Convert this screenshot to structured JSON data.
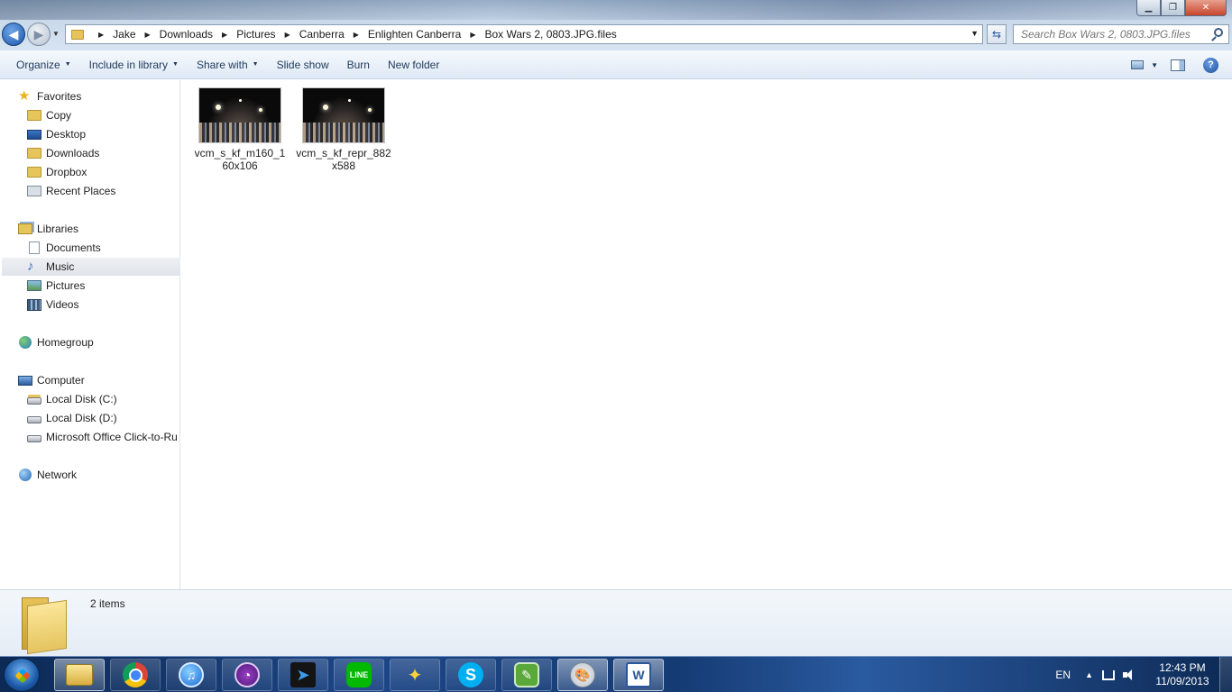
{
  "window": {
    "minimize_symbol": "▁",
    "restore_symbol": "❐",
    "close_symbol": "✕"
  },
  "address": {
    "breadcrumbs": [
      "Jake",
      "Downloads",
      "Pictures",
      "Canberra",
      "Enlighten Canberra",
      "Box Wars 2, 0803.JPG.files"
    ],
    "search_placeholder": "Search Box Wars 2, 0803.JPG.files"
  },
  "toolbar": {
    "organize": "Organize",
    "include_in_library": "Include in library",
    "share_with": "Share with",
    "slide_show": "Slide show",
    "burn": "Burn",
    "new_folder": "New folder",
    "help": "?"
  },
  "navigation": {
    "favorites": {
      "label": "Favorites",
      "items": [
        "Copy",
        "Desktop",
        "Downloads",
        "Dropbox",
        "Recent Places"
      ]
    },
    "libraries": {
      "label": "Libraries",
      "items": [
        "Documents",
        "Music",
        "Pictures",
        "Videos"
      ],
      "selected": "Music"
    },
    "homegroup": {
      "label": "Homegroup"
    },
    "computer": {
      "label": "Computer",
      "items": [
        "Local Disk (C:)",
        "Local Disk (D:)",
        "Microsoft Office Click-to-Ru"
      ]
    },
    "network": {
      "label": "Network"
    }
  },
  "files": [
    {
      "name": "vcm_s_kf_m160_160x106"
    },
    {
      "name": "vcm_s_kf_repr_882x588"
    }
  ],
  "details": {
    "item_count": "2 items"
  },
  "taskbar": {
    "apps": [
      {
        "icon": "windows-explorer-icon",
        "state": "active"
      },
      {
        "icon": "chrome-icon",
        "state": "pinned"
      },
      {
        "icon": "itunes-icon",
        "state": "pinned"
      },
      {
        "icon": "bittorrent-icon",
        "state": "pinned"
      },
      {
        "icon": "arrow-app-icon",
        "state": "pinned"
      },
      {
        "icon": "line-icon",
        "state": "pinned"
      },
      {
        "icon": "satellite-icon",
        "state": "pinned"
      },
      {
        "icon": "skype-icon",
        "state": "pinned"
      },
      {
        "icon": "evernote-icon",
        "state": "pinned"
      },
      {
        "icon": "paint-icon",
        "state": "active"
      },
      {
        "icon": "word-icon",
        "state": "active"
      }
    ],
    "line_label": "LINE",
    "skype_label": "S",
    "word_label": "W",
    "language": "EN",
    "time": "12:43 PM",
    "date": "11/09/2013"
  }
}
